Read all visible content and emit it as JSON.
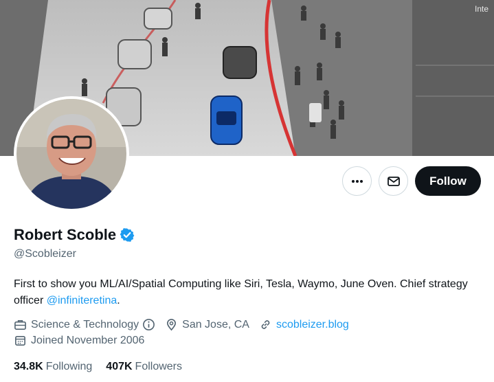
{
  "banner": {
    "corner_text": "Inte"
  },
  "profile": {
    "name": "Robert Scoble",
    "handle": "@Scobleizer",
    "bio_text": "First to show you ML/AI/Spatial Computing like Siri, Tesla, Waymo, June Oven. Chief strategy officer ",
    "bio_mention": "@infiniteretina",
    "bio_end": "."
  },
  "actions": {
    "more_icon": "more-dots-icon",
    "message_icon": "envelope-icon",
    "follow_label": "Follow"
  },
  "meta": {
    "category": "Science & Technology",
    "location": "San Jose, CA",
    "website": "scobleizer.blog",
    "joined": "Joined November 2006"
  },
  "stats": {
    "following_count": "34.8K",
    "following_label": "Following",
    "followers_count": "407K",
    "followers_label": "Followers"
  },
  "colors": {
    "accent": "#1d9bf0",
    "text": "#0f1419",
    "secondary": "#536471",
    "button_dark": "#0f1419"
  }
}
